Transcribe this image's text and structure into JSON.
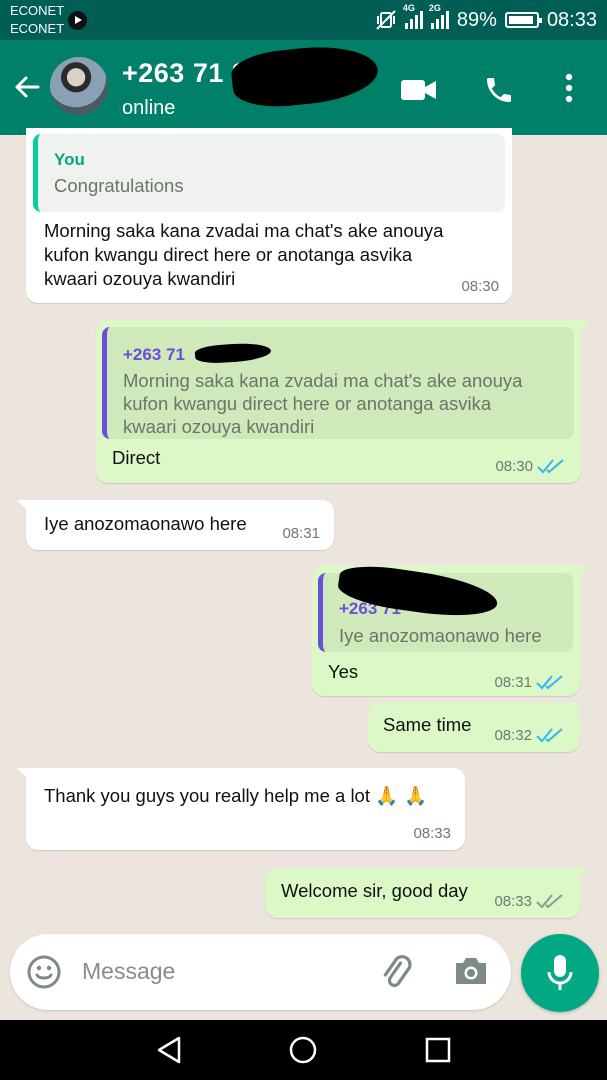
{
  "status_bar": {
    "carrier_1": "ECONET",
    "carrier_2": "ECONET",
    "net_1": "4G",
    "net_2": "2G",
    "battery": "89%",
    "time": "08:33"
  },
  "header": {
    "contact": "+263 71 8",
    "status": "online",
    "icons": [
      "back-arrow-icon",
      "avatar",
      "video-call-icon",
      "phone-icon",
      "more-vert-icon"
    ]
  },
  "messages": [
    {
      "direction": "incoming",
      "quote_author": "You",
      "quote_text": "Congratulations",
      "lines": [
        "Morning saka kana zvadai ma chat's ake anouya",
        "kufon kwangu direct here or anotanga asvika",
        "kwaari ozouya kwandiri"
      ],
      "time": "08:30"
    },
    {
      "direction": "outgoing",
      "quote_author": "+263 71",
      "quote_lines": [
        "Morning saka kana zvadai ma chat's ake anouya",
        "kufon kwangu direct here or anotanga asvika",
        "kwaari ozouya kwandiri"
      ],
      "text": "Direct",
      "time": "08:30",
      "read": true
    },
    {
      "direction": "incoming",
      "text": "Iye anozomaonawo here",
      "time": "08:31"
    },
    {
      "direction": "outgoing",
      "quote_author": "+263 71",
      "quote_text": "Iye anozomaonawo here",
      "text": "Yes",
      "time": "08:31",
      "read": true
    },
    {
      "direction": "outgoing",
      "text": "Same time",
      "time": "08:32",
      "read": true
    },
    {
      "direction": "incoming",
      "text": "Thank you guys you really help me a lot",
      "emoji": "🙏 🙏",
      "time": "08:33"
    },
    {
      "direction": "outgoing",
      "text": "Welcome sir, good day",
      "time": "08:33",
      "read": false
    }
  ],
  "composer": {
    "placeholder": "Message",
    "icons": [
      "emoji-icon",
      "attach-icon",
      "camera-icon",
      "mic-icon"
    ]
  },
  "colors": {
    "header": "#008069",
    "status_bar": "#005e54",
    "wallpaper": "#ece5dd",
    "outgoing_bubble": "#dcf8c6",
    "incoming_bubble": "#ffffff",
    "read_ticks": "#34b7f1",
    "accent": "#00a884"
  }
}
